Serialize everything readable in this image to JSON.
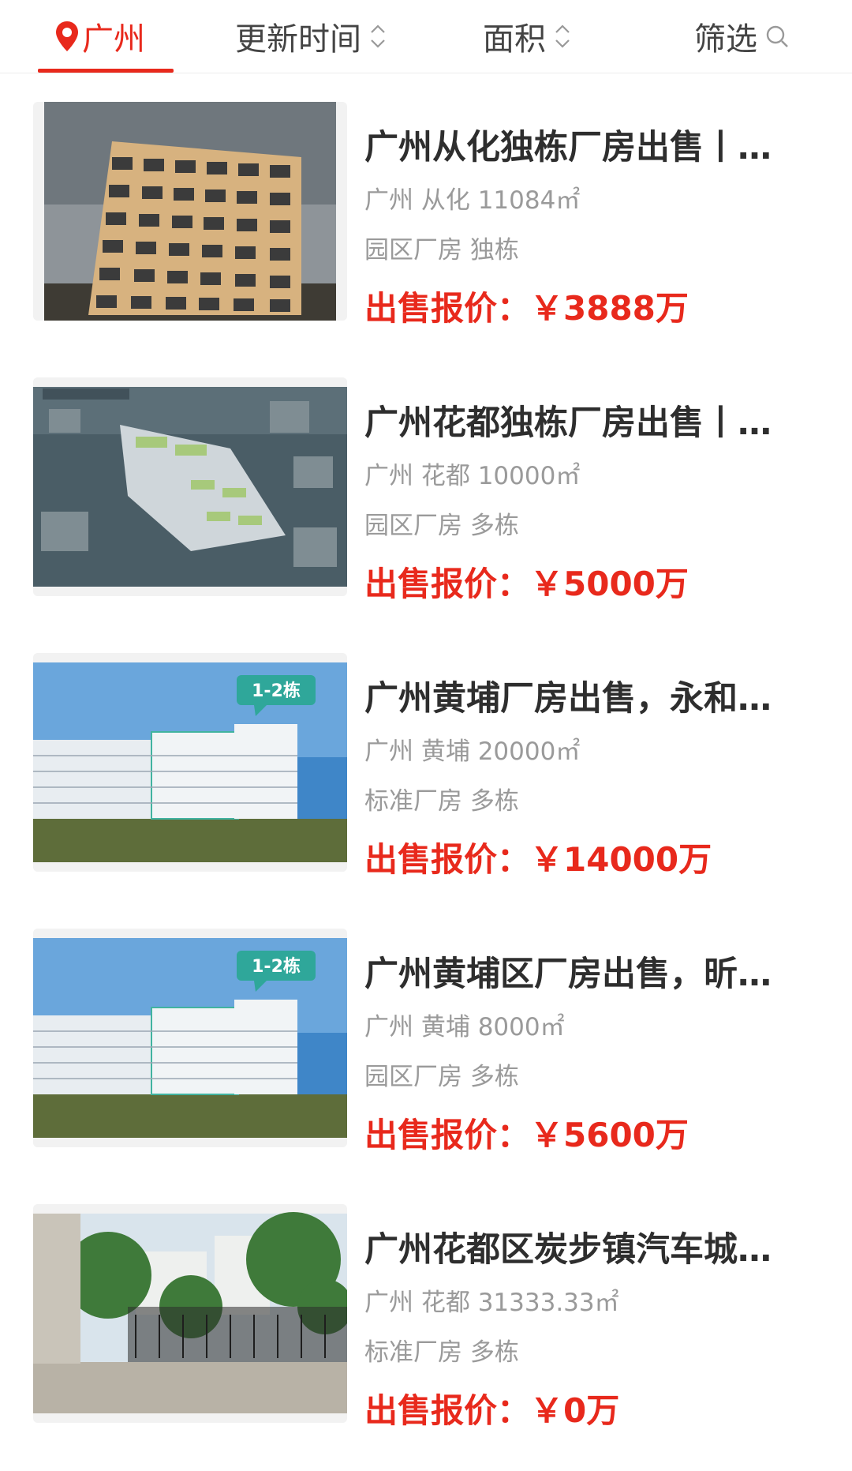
{
  "tabs": {
    "city": "广州",
    "updated": "更新时间",
    "area": "面积",
    "filter": "筛选"
  },
  "colors": {
    "accent": "#e8291c",
    "title": "#2e2e2e",
    "meta": "#9a9a9a"
  },
  "listings": [
    {
      "title": "广州从化独栋厂房出售丨…",
      "location": "广州 从化 11084㎡",
      "tags": "园区厂房 独栋",
      "price_label": "出售报价：",
      "price": "￥3888万"
    },
    {
      "title": "广州花都独栋厂房出售丨…",
      "location": "广州 花都 10000㎡",
      "tags": "园区厂房 多栋",
      "price_label": "出售报价：",
      "price": "￥5000万"
    },
    {
      "title": "广州黄埔厂房出售，永和…",
      "location": "广州 黄埔 20000㎡",
      "tags": "标准厂房 多栋",
      "price_label": "出售报价：",
      "price": "￥14000万",
      "badge": "1-2栋"
    },
    {
      "title": "广州黄埔区厂房出售，昕…",
      "location": "广州 黄埔 8000㎡",
      "tags": "园区厂房 多栋",
      "price_label": "出售报价：",
      "price": "￥5600万",
      "badge": "1-2栋"
    },
    {
      "title": "广州花都区炭步镇汽车城…",
      "location": "广州 花都 31333.33㎡",
      "tags": "标准厂房 多栋",
      "price_label": "出售报价：",
      "price": "￥0万"
    }
  ]
}
